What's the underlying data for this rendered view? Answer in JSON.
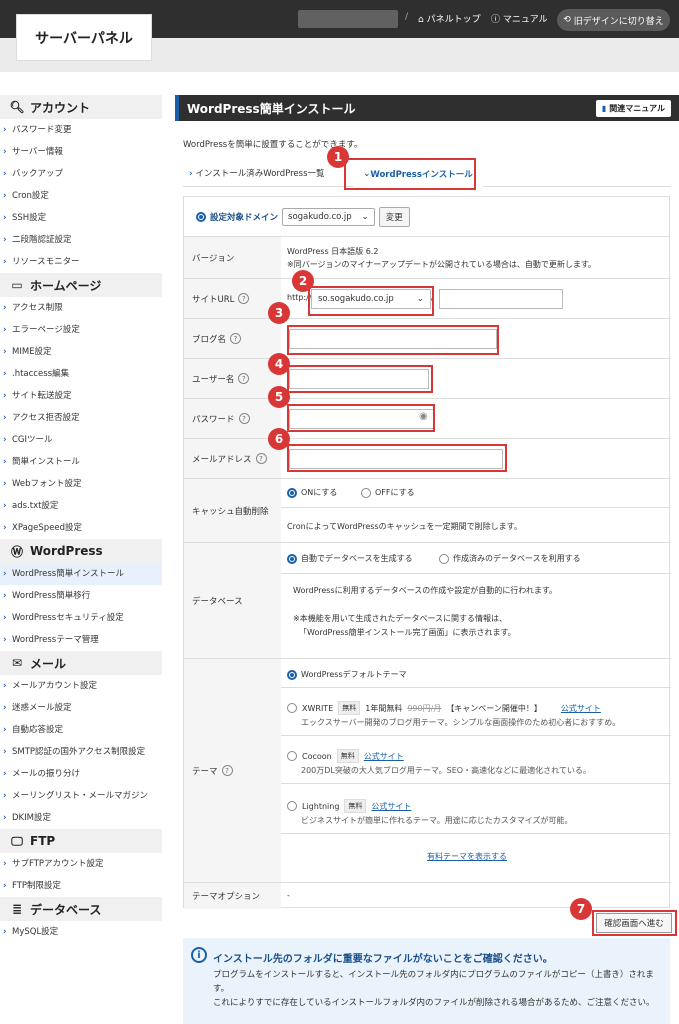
{
  "header": {
    "logo": "サーバーパネル",
    "nav": [
      "パネルトップ",
      "マニュアル"
    ],
    "sep": "/",
    "old_design": "旧デザインに切り替え"
  },
  "sidebar": {
    "sections": [
      {
        "title": "アカウント",
        "icon": "search-icon",
        "items": [
          "パスワード変更",
          "サーバー情報",
          "バックアップ",
          "Cron設定",
          "SSH設定",
          "二段階認証設定",
          "リソースモニター"
        ]
      },
      {
        "title": "ホームページ",
        "icon": "window-icon",
        "items": [
          "アクセス制限",
          "エラーページ設定",
          "MIME設定",
          ".htaccess編集",
          "サイト転送設定",
          "アクセス拒否設定",
          "CGIツール",
          "簡単インストール",
          "Webフォント設定",
          "ads.txt設定",
          "XPageSpeed設定"
        ]
      },
      {
        "title": "WordPress",
        "icon": "wordpress-icon",
        "items": [
          "WordPress簡単インストール",
          "WordPress簡単移行",
          "WordPressセキュリティ設定",
          "WordPressテーマ管理"
        ]
      },
      {
        "title": "メール",
        "icon": "mail-icon",
        "items": [
          "メールアカウント設定",
          "迷惑メール設定",
          "自動応答設定",
          "SMTP認証の国外アクセス制限設定",
          "メールの振り分け",
          "メーリングリスト・メールマガジン",
          "DKIM設定"
        ]
      },
      {
        "title": "FTP",
        "icon": "monitor-icon",
        "items": [
          "サブFTPアカウント設定",
          "FTP制限設定"
        ]
      },
      {
        "title": "データベース",
        "icon": "database-icon",
        "items": [
          "MySQL設定"
        ]
      }
    ]
  },
  "main": {
    "title": "WordPress簡単インストール",
    "manual": "関連マニュアル",
    "desc": "WordPressを簡単に設置することができます。",
    "tabs": [
      "インストール済みWordPress一覧",
      "WordPressインストール"
    ],
    "domain_label": "設定対象ドメイン",
    "domain_value": "sogakudo.co.jp",
    "change": "変更",
    "rows": {
      "version_label": "バージョン",
      "version_value": "WordPress 日本語版 6.2",
      "version_note": "※同バージョンのマイナーアップデートが公開されている場合は、自動で更新します。",
      "url_label": "サイトURL",
      "url_prefix": "http://",
      "url_domain": "so.sogakudo.co.jp",
      "url_slash": "/",
      "blog_label": "ブログ名",
      "user_label": "ユーザー名",
      "pass_label": "パスワード",
      "mail_label": "メールアドレス",
      "cache_label": "キャッシュ自動削除",
      "cache_on": "ONにする",
      "cache_off": "OFFにする",
      "cache_note": "CronによってWordPressのキャッシュを一定期間で削除します。",
      "db_label": "データベース",
      "db_auto": "自動でデータベースを生成する",
      "db_existing": "作成済みのデータベースを利用する",
      "db_note1": "WordPressに利用するデータベースの作成や設定が自動的に行われます。",
      "db_note2": "※本機能を用いて生成されたデータベースに関する情報は、",
      "db_note3": "「WordPress簡単インストール完了画面」に表示されます。",
      "theme_label": "テーマ",
      "theme_default": "WordPressデフォルトテーマ",
      "xwrite": "XWRITE",
      "free": "無料",
      "xwrite_promo": "1年間無料",
      "xwrite_price": "990円/月",
      "xwrite_campaign": "【キャンペーン開催中！】",
      "official": "公式サイト",
      "xwrite_desc": "エックスサーバー開発のブログ用テーマ。シンプルな画面操作のため初心者におすすめ。",
      "cocoon": "Cocoon",
      "cocoon_desc": "200万DL突破の大人気ブログ用テーマ。SEO・高速化などに最適化されている。",
      "lightning": "Lightning",
      "lightning_desc": "ビジネスサイトが簡単に作れるテーマ。用途に応じたカスタマイズが可能。",
      "paid_link": "有料テーマを表示する",
      "option_label": "テーマオプション",
      "option_value": "-"
    },
    "confirm": "確認画面へ進む",
    "info_title": "インストール先のフォルダに重要なファイルがないことをご確認ください。",
    "info_body1": "プログラムをインストールすると、インストール先のフォルダ内にプログラムのファイルがコピー（上書き）されます。",
    "info_body2": "これによりすでに存在しているインストールフォルダ内のファイルが削除される場合があるため、ご注意ください。"
  },
  "badges": [
    "1",
    "2",
    "3",
    "4",
    "5",
    "6",
    "7"
  ],
  "colors": {
    "accent": "#1a5fa8",
    "annotation": "#d93636",
    "header": "#2f2f2f"
  }
}
